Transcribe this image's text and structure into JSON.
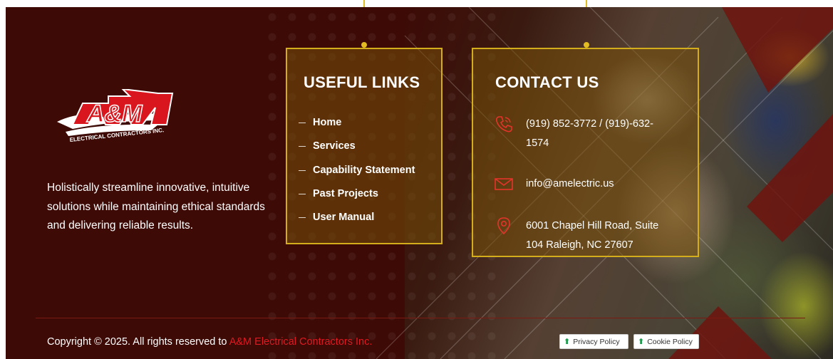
{
  "brand": {
    "logo_main": "A&M",
    "logo_sub": "ELECTRICAL CONTRACTORS INC."
  },
  "about": {
    "text": "Holistically streamline innovative, intuitive solutions while maintaining ethical standards and delivering reliable results."
  },
  "useful_links": {
    "title": "USEFUL LINKS",
    "items": [
      {
        "label": "Home"
      },
      {
        "label": "Services"
      },
      {
        "label": "Capability Statement"
      },
      {
        "label": "Past Projects"
      },
      {
        "label": "User Manual"
      }
    ]
  },
  "contact": {
    "title": "CONTACT US",
    "phone": "(919) 852-3772 / (919)-632-1574",
    "email": "info@amelectric.us",
    "address": "6001 Chapel Hill Road, Suite 104 Raleigh, NC 27607",
    "icons": [
      "phone-icon",
      "mail-icon",
      "location-pin-icon"
    ]
  },
  "footer": {
    "copyright_prefix": "Copyright © 2025. All rights reserved to ",
    "copyright_brand": "A&M Electrical Contractors Inc.",
    "privacy_label": "Privacy Policy",
    "cookie_label": "Cookie Policy"
  },
  "colors": {
    "background": "#3d0a06",
    "accent_gold": "#d4ad1d",
    "brand_red": "#e01a22",
    "text": "#ffffff"
  }
}
